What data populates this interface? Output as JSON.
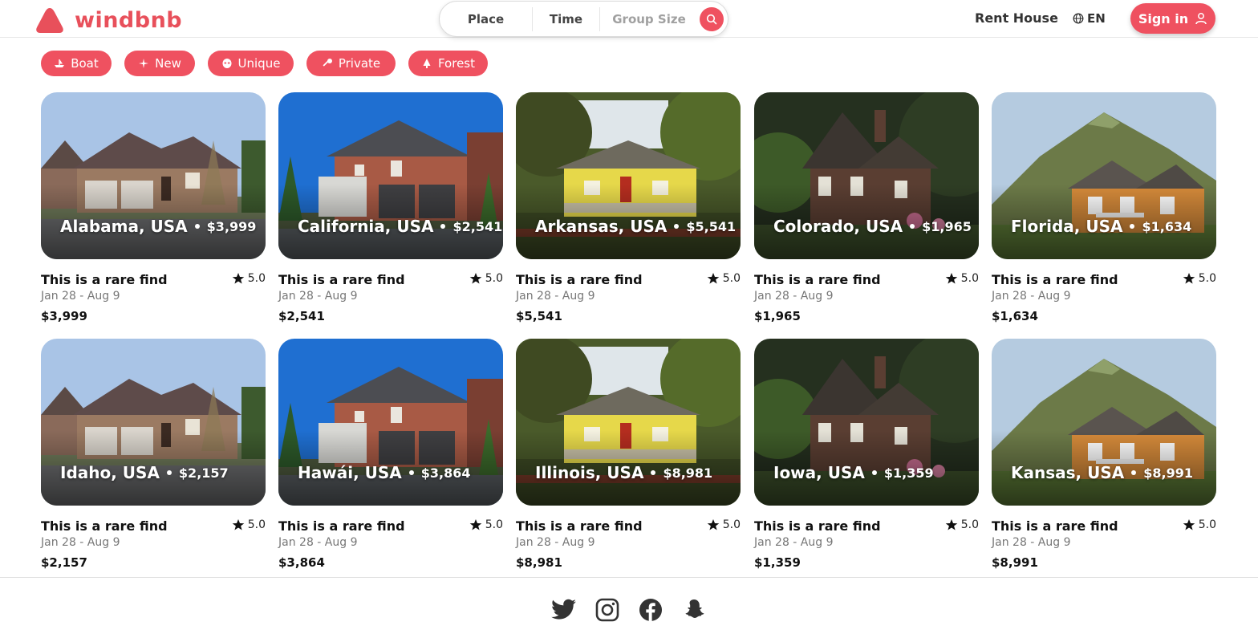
{
  "brand": {
    "name": "windbnb",
    "color": "#e8505b"
  },
  "search": {
    "place_label": "Place",
    "time_label": "Time",
    "group_label": "Group Size",
    "search_icon": "search-icon"
  },
  "nav": {
    "rent_label": "Rent House",
    "lang_label": "EN",
    "signin_label": "Sign in"
  },
  "filters": [
    {
      "label": "Boat",
      "icon": "boat-icon"
    },
    {
      "label": "New",
      "icon": "sparkle-icon"
    },
    {
      "label": "Unique",
      "icon": "alien-icon"
    },
    {
      "label": "Private",
      "icon": "key-icon"
    },
    {
      "label": "Forest",
      "icon": "tree-icon"
    }
  ],
  "listings": [
    {
      "location": "Alabama, USA",
      "overlay_price": "$3,999",
      "title": "This is a rare find",
      "rating": "5.0",
      "dates": "Jan 28 - Aug 9",
      "price": "$3,999"
    },
    {
      "location": "California, USA",
      "overlay_price": "$2,541",
      "title": "This is a rare find",
      "rating": "5.0",
      "dates": "Jan 28 - Aug 9",
      "price": "$2,541"
    },
    {
      "location": "Arkansas, USA",
      "overlay_price": "$5,541",
      "title": "This is a rare find",
      "rating": "5.0",
      "dates": "Jan 28 - Aug 9",
      "price": "$5,541"
    },
    {
      "location": "Colorado, USA",
      "overlay_price": "$1,965",
      "title": "This is a rare find",
      "rating": "5.0",
      "dates": "Jan 28 - Aug 9",
      "price": "$1,965"
    },
    {
      "location": "Florida, USA",
      "overlay_price": "$1,634",
      "title": "This is a rare find",
      "rating": "5.0",
      "dates": "Jan 28 - Aug 9",
      "price": "$1,634"
    },
    {
      "location": "Idaho, USA",
      "overlay_price": "$2,157",
      "title": "This is a rare find",
      "rating": "5.0",
      "dates": "Jan 28 - Aug 9",
      "price": "$2,157"
    },
    {
      "location": "Hawái, USA",
      "overlay_price": "$3,864",
      "title": "This is a rare find",
      "rating": "5.0",
      "dates": "Jan 28 - Aug 9",
      "price": "$3,864"
    },
    {
      "location": "Illinois, USA",
      "overlay_price": "$8,981",
      "title": "This is a rare find",
      "rating": "5.0",
      "dates": "Jan 28 - Aug 9",
      "price": "$8,981"
    },
    {
      "location": "Iowa, USA",
      "overlay_price": "$1,359",
      "title": "This is a rare find",
      "rating": "5.0",
      "dates": "Jan 28 - Aug 9",
      "price": "$1,359"
    },
    {
      "location": "Kansas, USA",
      "overlay_price": "$8,991",
      "title": "This is a rare find",
      "rating": "5.0",
      "dates": "Jan 28 - Aug 9",
      "price": "$8,991"
    }
  ],
  "footer": {
    "icons": [
      "twitter-icon",
      "instagram-icon",
      "facebook-icon",
      "snapchat-icon"
    ]
  },
  "colors": {
    "accent": "#ef5160"
  }
}
